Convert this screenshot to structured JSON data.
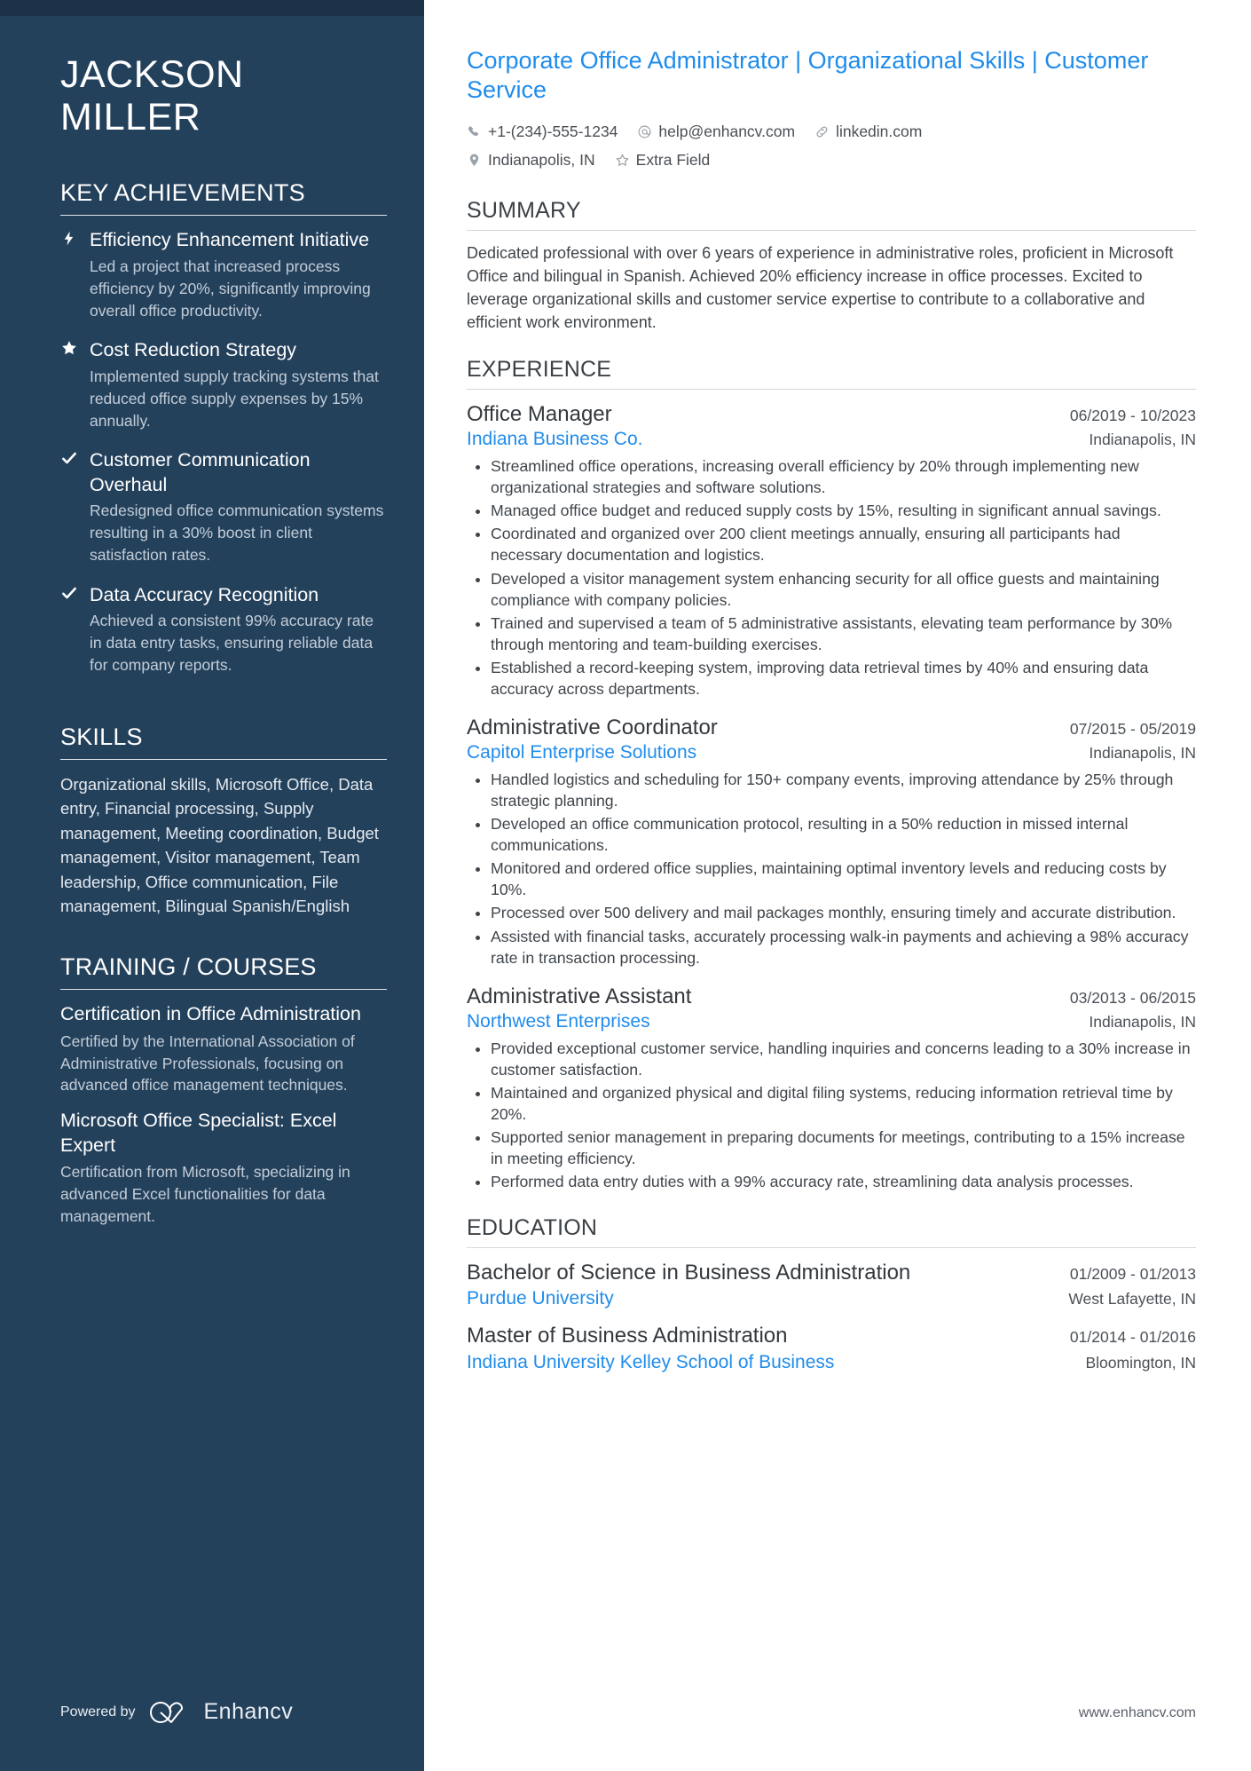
{
  "colors": {
    "sidebar_bg": "#24415c",
    "accent_blue": "#1f8ceb",
    "body_text": "#3f454b"
  },
  "sidebar": {
    "name_first": "JACKSON",
    "name_last": "MILLER",
    "key_achievements_heading": "KEY ACHIEVEMENTS",
    "achievements": [
      {
        "icon": "lightning-bolt-icon",
        "title": "Efficiency Enhancement Initiative",
        "desc": "Led a project that increased process efficiency by 20%, significantly improving overall office productivity."
      },
      {
        "icon": "star-icon",
        "title": "Cost Reduction Strategy",
        "desc": "Implemented supply tracking systems that reduced office supply expenses by 15% annually."
      },
      {
        "icon": "check-icon",
        "title": "Customer Communication Overhaul",
        "desc": "Redesigned office communication systems resulting in a 30% boost in client satisfaction rates."
      },
      {
        "icon": "check-icon",
        "title": "Data Accuracy Recognition",
        "desc": "Achieved a consistent 99% accuracy rate in data entry tasks, ensuring reliable data for company reports."
      }
    ],
    "skills_heading": "SKILLS",
    "skills_text": "Organizational skills, Microsoft Office, Data entry, Financial processing, Supply management, Meeting coordination, Budget management, Visitor management, Team leadership, Office communication, File management, Bilingual Spanish/English",
    "training_heading": "TRAINING / COURSES",
    "courses": [
      {
        "title": "Certification in Office Administration",
        "desc": "Certified by the International Association of Administrative Professionals, focusing on advanced office management techniques."
      },
      {
        "title": "Microsoft Office Specialist: Excel Expert",
        "desc": "Certification from Microsoft, specializing in advanced Excel functionalities for data management."
      }
    ],
    "powered_by_label": "Powered by",
    "powered_by_brand": "Enhancv"
  },
  "main": {
    "headline": "Corporate Office Administrator | Organizational Skills | Customer Service",
    "contacts": [
      {
        "icon": "phone-icon",
        "text": "+1-(234)-555-1234"
      },
      {
        "icon": "email-at-icon",
        "text": "help@enhancv.com"
      },
      {
        "icon": "link-icon",
        "text": "linkedin.com"
      },
      {
        "icon": "location-pin-icon",
        "text": "Indianapolis, IN"
      },
      {
        "icon": "star-outline-icon",
        "text": "Extra Field"
      }
    ],
    "summary_heading": "SUMMARY",
    "summary_text": "Dedicated professional with over 6 years of experience in administrative roles, proficient in Microsoft Office and bilingual in Spanish. Achieved 20% efficiency increase in office processes. Excited to leverage organizational skills and customer service expertise to contribute to a collaborative and efficient work environment.",
    "experience_heading": "EXPERIENCE",
    "jobs": [
      {
        "title": "Office Manager",
        "date": "06/2019 - 10/2023",
        "company": "Indiana Business Co.",
        "location": "Indianapolis, IN",
        "bullets": [
          "Streamlined office operations, increasing overall efficiency by 20% through implementing new organizational strategies and software solutions.",
          "Managed office budget and reduced supply costs by 15%, resulting in significant annual savings.",
          "Coordinated and organized over 200 client meetings annually, ensuring all participants had necessary documentation and logistics.",
          "Developed a visitor management system enhancing security for all office guests and maintaining compliance with company policies.",
          "Trained and supervised a team of 5 administrative assistants, elevating team performance by 30% through mentoring and team-building exercises.",
          "Established a record-keeping system, improving data retrieval times by 40% and ensuring data accuracy across departments."
        ]
      },
      {
        "title": "Administrative Coordinator",
        "date": "07/2015 - 05/2019",
        "company": "Capitol Enterprise Solutions",
        "location": "Indianapolis, IN",
        "bullets": [
          "Handled logistics and scheduling for 150+ company events, improving attendance by 25% through strategic planning.",
          "Developed an office communication protocol, resulting in a 50% reduction in missed internal communications.",
          "Monitored and ordered office supplies, maintaining optimal inventory levels and reducing costs by 10%.",
          "Processed over 500 delivery and mail packages monthly, ensuring timely and accurate distribution.",
          "Assisted with financial tasks, accurately processing walk-in payments and achieving a 98% accuracy rate in transaction processing."
        ]
      },
      {
        "title": "Administrative Assistant",
        "date": "03/2013 - 06/2015",
        "company": "Northwest Enterprises",
        "location": "Indianapolis, IN",
        "bullets": [
          "Provided exceptional customer service, handling inquiries and concerns leading to a 30% increase in customer satisfaction.",
          "Maintained and organized physical and digital filing systems, reducing information retrieval time by 20%.",
          "Supported senior management in preparing documents for meetings, contributing to a 15% increase in meeting efficiency.",
          "Performed data entry duties with a 99% accuracy rate, streamlining data analysis processes."
        ]
      }
    ],
    "education_heading": "EDUCATION",
    "education": [
      {
        "degree": "Bachelor of Science in Business Administration",
        "date": "01/2009 - 01/2013",
        "school": "Purdue University",
        "location": "West Lafayette, IN"
      },
      {
        "degree": "Master of Business Administration",
        "date": "01/2014 - 01/2016",
        "school": "Indiana University Kelley School of Business",
        "location": "Bloomington, IN"
      }
    ],
    "website": "www.enhancv.com"
  }
}
